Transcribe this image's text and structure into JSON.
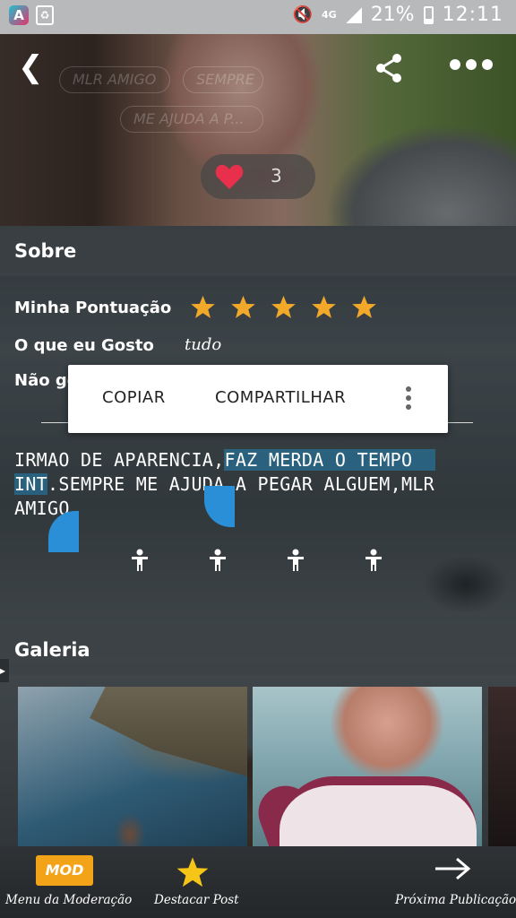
{
  "status_bar": {
    "battery_pct": "21%",
    "network": "4G",
    "time": "12:11",
    "icons": [
      "app-a-icon",
      "recycle-icon",
      "mute-icon",
      "signal-icon",
      "battery-icon"
    ]
  },
  "header": {
    "back_icon": "back-arrow-icon",
    "share_icon": "share-icon",
    "more_icon": "more-horizontal-icon",
    "tags": [
      "MLR AMIGO",
      "SEMPRE",
      "ME AJUDA A P..."
    ],
    "like_count": "3",
    "heart_color": "#e8304c"
  },
  "about": {
    "section_title": "Sobre",
    "rating_label": "Minha Pontuação",
    "rating": 5,
    "star_color": "#f2a92a",
    "likes_label": "O que eu Gosto",
    "likes_value": "tudo",
    "dislikes_label_partial": "Não go"
  },
  "context_menu": {
    "copy": "COPIAR",
    "share": "COMPARTILHAR",
    "more_icon": "more-vertical-icon"
  },
  "bio": {
    "line1_plain": "IRMAO DE APARENCIA,",
    "line1_selected": "FAZ MERDA O TEMPO",
    "line2_selected": "INT",
    "line2_plain": ".SEMPRE ME AJUDA A PEGAR ALGUEM,MLR",
    "line3_plain": "AMIGO"
  },
  "gallery": {
    "section_title": "Galeria"
  },
  "bottom_bar": {
    "mod_badge": "MOD",
    "mod_label": "Menu da Moderação",
    "feature_label": "Destacar Post",
    "next_label": "Próxima Publicação",
    "accent_color": "#f2a317"
  }
}
